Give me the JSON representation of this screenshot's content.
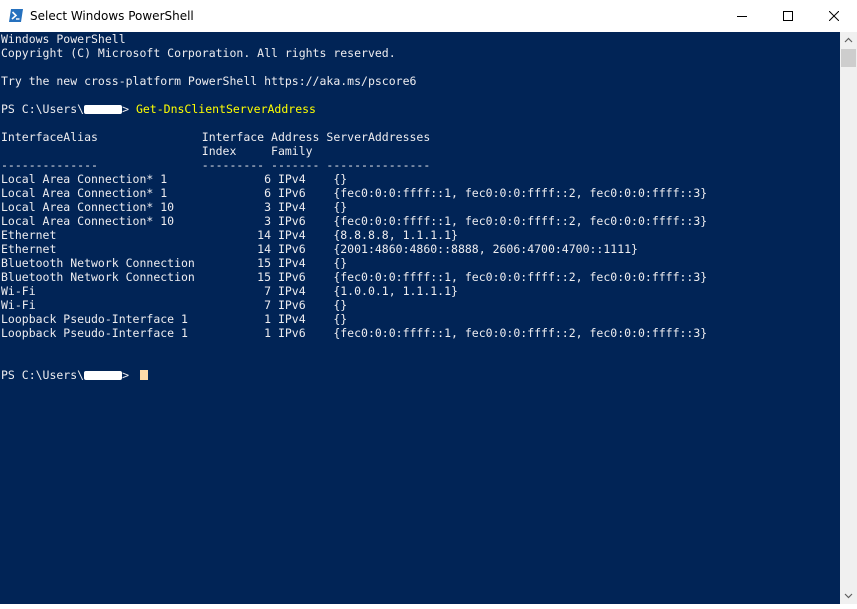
{
  "window": {
    "title": "Select Windows PowerShell",
    "app_icon": "powershell-icon",
    "controls": {
      "minimize": "minimize-icon",
      "maximize": "maximize-icon",
      "close": "close-icon"
    }
  },
  "colors": {
    "console_bg": "#012456",
    "console_text": "#eeedf0",
    "command_text": "#ffff00",
    "cursor": "#fedba9"
  },
  "console": {
    "banner": [
      "Windows PowerShell",
      "Copyright (C) Microsoft Corporation. All rights reserved.",
      "",
      "Try the new cross-platform PowerShell https://aka.ms/pscore6"
    ],
    "prompt_prefix": "PS C:\\Users\\",
    "prompt_suffix": "> ",
    "command": "Get-DnsClientServerAddress",
    "table": {
      "header_line1": "InterfaceAlias               Interface Address ServerAddresses",
      "header_line2": "                             Index     Family",
      "separator": "--------------               --------- ------- ---------------",
      "rows": [
        "Local Area Connection* 1              6 IPv4    {}",
        "Local Area Connection* 1              6 IPv6    {fec0:0:0:ffff::1, fec0:0:0:ffff::2, fec0:0:0:ffff::3}",
        "Local Area Connection* 10             3 IPv4    {}",
        "Local Area Connection* 10             3 IPv6    {fec0:0:0:ffff::1, fec0:0:0:ffff::2, fec0:0:0:ffff::3}",
        "Ethernet                             14 IPv4    {8.8.8.8, 1.1.1.1}",
        "Ethernet                             14 IPv6    {2001:4860:4860::8888, 2606:4700:4700::1111}",
        "Bluetooth Network Connection         15 IPv4    {}",
        "Bluetooth Network Connection         15 IPv6    {fec0:0:0:ffff::1, fec0:0:0:ffff::2, fec0:0:0:ffff::3}",
        "Wi-Fi                                 7 IPv4    {1.0.0.1, 1.1.1.1}",
        "Wi-Fi                                 7 IPv6    {}",
        "Loopback Pseudo-Interface 1           1 IPv4    {}",
        "Loopback Pseudo-Interface 1           1 IPv6    {fec0:0:0:ffff::1, fec0:0:0:ffff::2, fec0:0:0:ffff::3}"
      ]
    }
  }
}
